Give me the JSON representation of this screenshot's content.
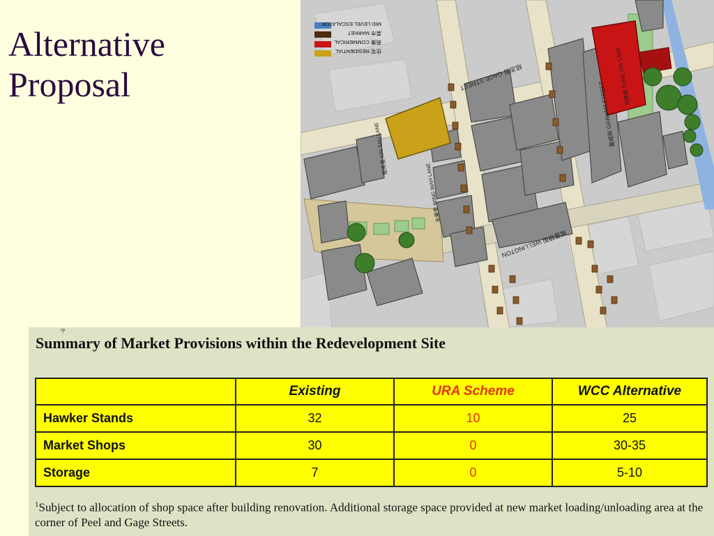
{
  "slide": {
    "title_line1": "Alternative",
    "title_line2": "Proposal"
  },
  "map": {
    "legend": [
      {
        "label": "MID LEVEL ESCALATOR",
        "color": "#4a7fbf"
      },
      {
        "label": "菜市 MARKET",
        "color": "#4a2c10"
      },
      {
        "label": "商業 COMMERICAL",
        "color": "#c81414"
      },
      {
        "label": "住宅 RESIDENTIAL",
        "color": "#c9a21a"
      }
    ],
    "street_labels": {
      "gage": "結志街 GAGE STREET",
      "wellington": "威靈頓街 WELLINGTON",
      "graham": "嘉咸街 GRAHAM STREET",
      "tung_tak": "同德里 TUNG TAK LANE",
      "kin_sau": "堅秀里 KIN SAU LANE",
      "wing_wah": "永華里 WING WAH LANE"
    }
  },
  "summary": {
    "marker": "²|²",
    "heading": "Summary of Market Provisions within the Redevelopment Site",
    "columns": [
      "",
      "Existing",
      "URA Scheme",
      "WCC Alternative"
    ],
    "rows": [
      {
        "label": "Hawker Stands",
        "existing": "32",
        "ura": "10",
        "wcc": "25"
      },
      {
        "label": "Market Shops",
        "existing": "30",
        "ura": "0",
        "wcc": "30-35"
      },
      {
        "label": "Storage",
        "existing": "7",
        "ura": "0",
        "wcc": "5-10"
      }
    ],
    "footnote_mark": "1",
    "footnote": "Subject to allocation of shop space after building renovation. Additional storage space provided at new market loading/unloading area at the corner of Peel and Gage Streets."
  }
}
